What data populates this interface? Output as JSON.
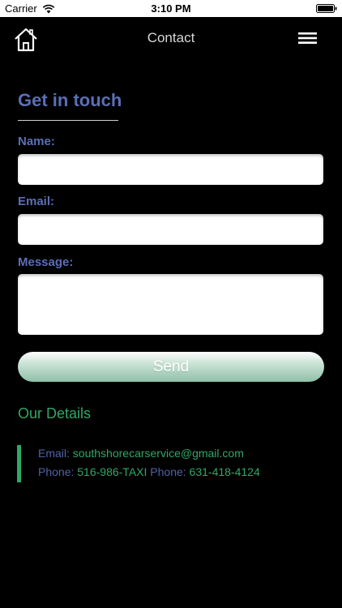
{
  "status_bar": {
    "carrier": "Carrier",
    "time": "3:10 PM"
  },
  "header": {
    "title": "Contact",
    "home_icon": "home-icon",
    "menu_icon": "hamburger-menu-icon"
  },
  "form": {
    "title": "Get in touch",
    "name_label": "Name:",
    "name_value": "",
    "email_label": "Email:",
    "email_value": "",
    "message_label": "Message:",
    "message_value": "",
    "send_label": "Send"
  },
  "details": {
    "title": "Our Details",
    "email_label": "Email:",
    "email_value": "southshorecarservice@gmail.com",
    "phone_label_1": "Phone:",
    "phone_value_1": "516-986-TAXI",
    "phone_label_2": "Phone:",
    "phone_value_2": "631-418-4124"
  },
  "colors": {
    "label_blue": "#5b6fb5",
    "accent_green": "#2fa866",
    "background": "#000000"
  }
}
